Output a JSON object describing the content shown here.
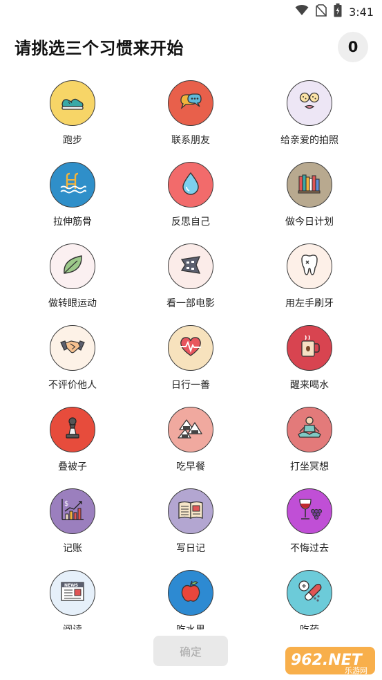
{
  "status_bar": {
    "time": "3:41",
    "icons": [
      "wifi-icon",
      "no-sim-icon",
      "battery-charging-icon"
    ]
  },
  "header": {
    "title": "请挑选三个习惯来开始",
    "selected_count": "0"
  },
  "habits": [
    {
      "label": "跑步",
      "icon": "running-shoe-icon",
      "bg": "#f7d567"
    },
    {
      "label": "联系朋友",
      "icon": "chat-bubbles-icon",
      "bg": "#e8604b"
    },
    {
      "label": "给亲爱的拍照",
      "icon": "face-mask-icon",
      "bg": "#ede6f5"
    },
    {
      "label": "拉伸筋骨",
      "icon": "swimming-pool-icon",
      "bg": "#2f8fc9"
    },
    {
      "label": "反思自己",
      "icon": "water-drop-icon",
      "bg": "#f26b6b"
    },
    {
      "label": "做今日计划",
      "icon": "bookshelf-icon",
      "bg": "#b8a98f"
    },
    {
      "label": "做转眼运动",
      "icon": "leaf-icon",
      "bg": "#fbf0f1"
    },
    {
      "label": "看一部电影",
      "icon": "film-strip-icon",
      "bg": "#fbece9"
    },
    {
      "label": "用左手刷牙",
      "icon": "tooth-icon",
      "bg": "#fdf0e8"
    },
    {
      "label": "不评价他人",
      "icon": "handshake-icon",
      "bg": "#fdf2e7"
    },
    {
      "label": "日行一善",
      "icon": "heartbeat-icon",
      "bg": "#f7e2bd"
    },
    {
      "label": "醒来喝水",
      "icon": "coffee-mug-icon",
      "bg": "#d84450"
    },
    {
      "label": "叠被子",
      "icon": "chess-pawn-icon",
      "bg": "#e74c3c"
    },
    {
      "label": "吃早餐",
      "icon": "rice-ball-icon",
      "bg": "#f0a99f"
    },
    {
      "label": "打坐冥想",
      "icon": "meditation-icon",
      "bg": "#e37a7a"
    },
    {
      "label": "记账",
      "icon": "finance-chart-icon",
      "bg": "#9b7fbe"
    },
    {
      "label": "写日记",
      "icon": "open-book-icon",
      "bg": "#b3a6d1"
    },
    {
      "label": "不悔过去",
      "icon": "wine-grapes-icon",
      "bg": "#c04fd6"
    },
    {
      "label": "阅读",
      "icon": "newspaper-icon",
      "bg": "#e6f0fa"
    },
    {
      "label": "吃水果",
      "icon": "apple-icon",
      "bg": "#2d8ad2"
    },
    {
      "label": "吃药",
      "icon": "pills-icon",
      "bg": "#6ccbd9"
    }
  ],
  "footer": {
    "confirm_label": "确定"
  },
  "watermark": {
    "brand": "962.NET",
    "sub": "乐游网"
  }
}
